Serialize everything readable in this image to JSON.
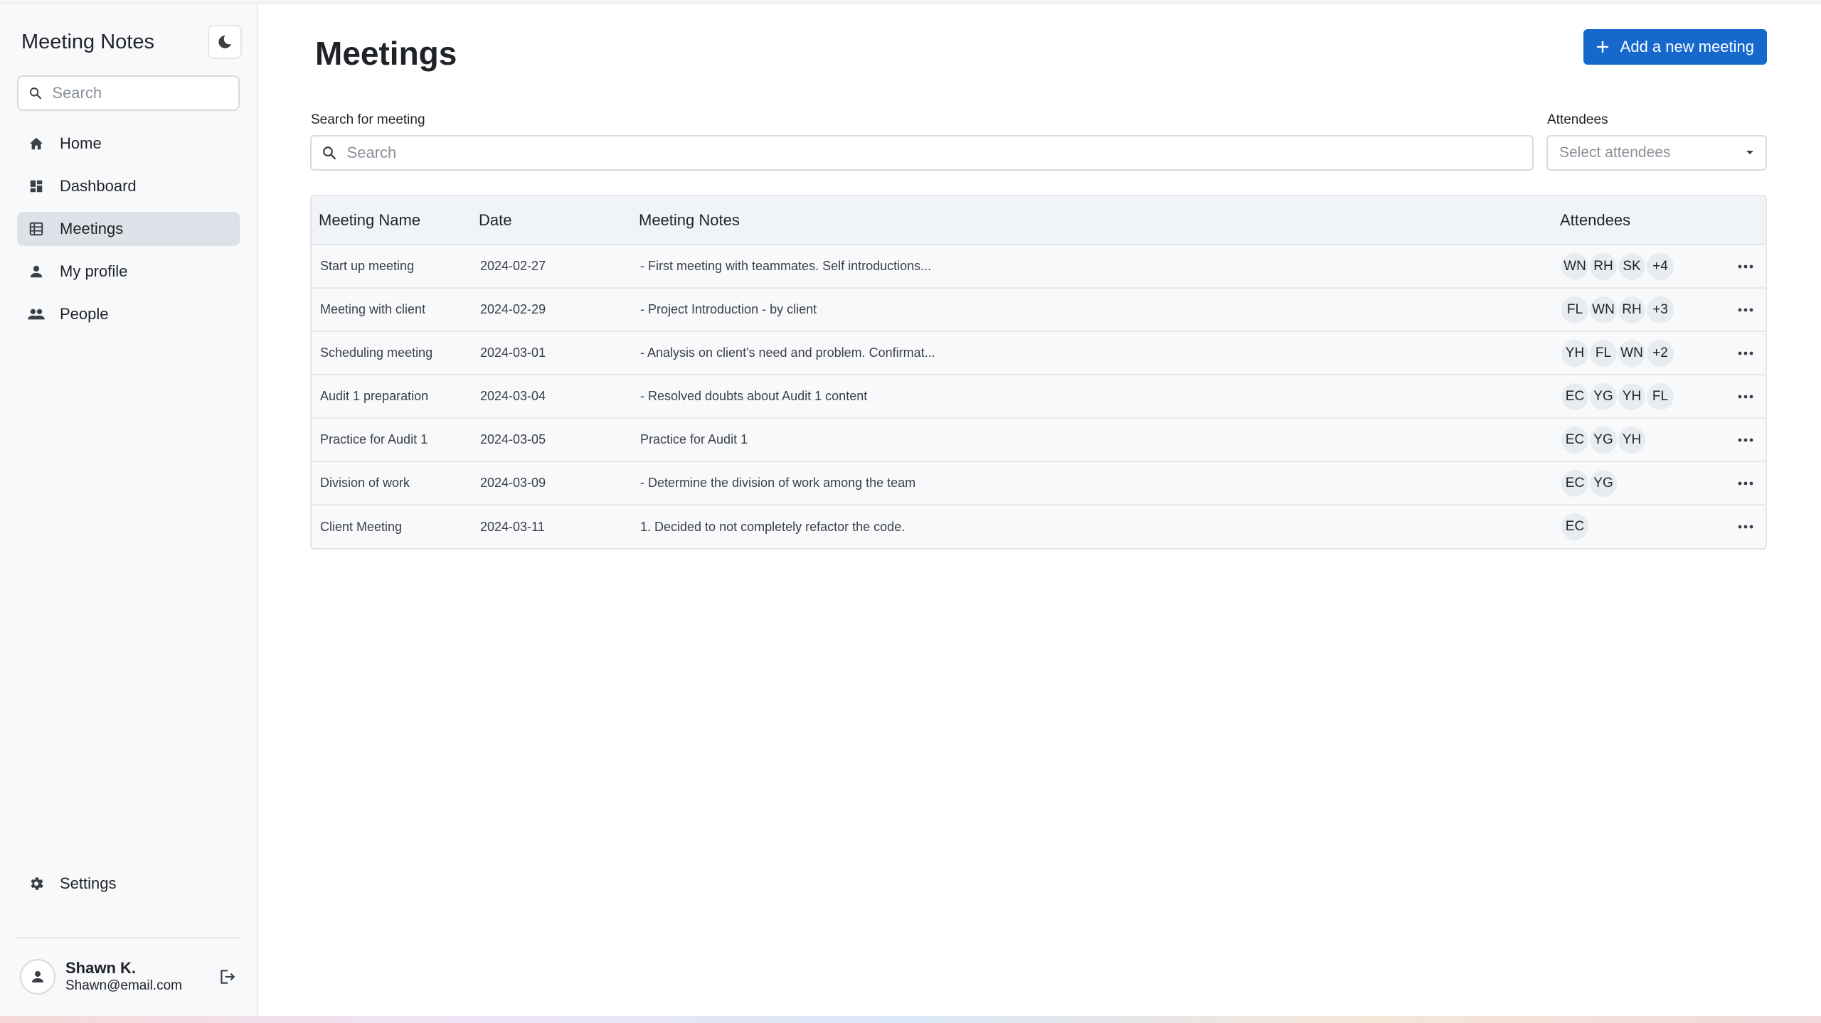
{
  "app": {
    "title": "Meeting Notes"
  },
  "sidebar": {
    "search_placeholder": "Search",
    "items": [
      {
        "label": "Home",
        "icon": "home-icon"
      },
      {
        "label": "Dashboard",
        "icon": "dashboard-icon"
      },
      {
        "label": "Meetings",
        "icon": "list-icon",
        "active": true
      },
      {
        "label": "My profile",
        "icon": "person-icon"
      },
      {
        "label": "People",
        "icon": "people-icon"
      }
    ],
    "settings_label": "Settings",
    "user": {
      "name": "Shawn K.",
      "email": "Shawn@email.com"
    }
  },
  "main": {
    "title": "Meetings",
    "add_button_label": "Add a new meeting",
    "search_label": "Search for meeting",
    "search_placeholder": "Search",
    "attendees_label": "Attendees",
    "attendees_placeholder": "Select attendees",
    "columns": [
      "Meeting Name",
      "Date",
      "Meeting Notes",
      "Attendees"
    ],
    "rows": [
      {
        "name": "Start up meeting",
        "date": "2024-02-27",
        "notes": "- First meeting with teammates. Self introductions...",
        "attendees": [
          "WN",
          "RH",
          "SK",
          "+4"
        ]
      },
      {
        "name": "Meeting with client",
        "date": "2024-02-29",
        "notes": "- Project Introduction - by client",
        "attendees": [
          "FL",
          "WN",
          "RH",
          "+3"
        ]
      },
      {
        "name": "Scheduling meeting",
        "date": "2024-03-01",
        "notes": "- Analysis on client's need and problem. Confirmat...",
        "attendees": [
          "YH",
          "FL",
          "WN",
          "+2"
        ]
      },
      {
        "name": "Audit 1 preparation",
        "date": "2024-03-04",
        "notes": "- Resolved doubts about Audit 1 content",
        "attendees": [
          "EC",
          "YG",
          "YH",
          "FL"
        ]
      },
      {
        "name": "Practice for Audit 1",
        "date": "2024-03-05",
        "notes": "Practice for Audit 1",
        "attendees": [
          "EC",
          "YG",
          "YH"
        ]
      },
      {
        "name": "Division of work",
        "date": "2024-03-09",
        "notes": "- Determine the division of work among the team",
        "attendees": [
          "EC",
          "YG"
        ]
      },
      {
        "name": "Client Meeting",
        "date": "2024-03-11",
        "notes": "1. Decided to not completely refactor the code.",
        "attendees": [
          "EC"
        ]
      }
    ]
  },
  "colors": {
    "accent": "#1668cc",
    "active_nav": "#dde2e8",
    "sidebar_bg": "#f8f9fb"
  }
}
